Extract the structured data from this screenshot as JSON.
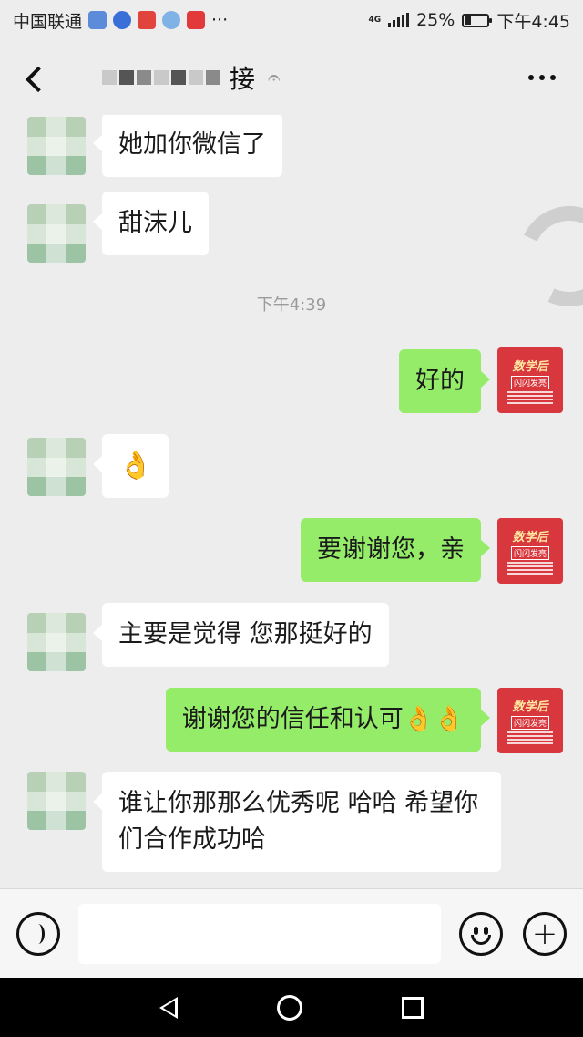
{
  "status_bar": {
    "carrier": "中国联通",
    "network": "4G",
    "battery": "25%",
    "battery_level": 0.25,
    "time": "下午4:45",
    "more": "···"
  },
  "header": {
    "title_visible": "接",
    "back_icon": "back-arrow-icon",
    "ear_icon": "ear-icon",
    "more_icon": "more-dots-icon"
  },
  "messages": [
    {
      "side": "in",
      "text": "她加你微信了"
    },
    {
      "side": "in",
      "text": "甜沫儿"
    },
    {
      "side": "time",
      "text": "下午4:39"
    },
    {
      "side": "out",
      "text": "好的"
    },
    {
      "side": "in",
      "text": "👌"
    },
    {
      "side": "out",
      "text": "要谢谢您，亲"
    },
    {
      "side": "in",
      "text": "主要是觉得 您那挺好的"
    },
    {
      "side": "out",
      "text": "谢谢您的信任和认可👌👌"
    },
    {
      "side": "in",
      "text": "谁让你那那么优秀呢 哈哈  希望你们合作成功哈"
    }
  ],
  "self_avatar": {
    "brand": "数学后",
    "box": "闪闪发亮"
  },
  "input_bar": {
    "voice_icon": "voice-icon",
    "emoji_icon": "emoji-icon",
    "plus_icon": "plus-icon",
    "plus": "+"
  },
  "nav_bar": {
    "back_icon": "nav-back-icon",
    "home_icon": "nav-home-icon",
    "recent_icon": "nav-recent-icon"
  },
  "colors": {
    "background": "#ededed",
    "bubble_out": "#95ec69",
    "bubble_in": "#ffffff",
    "brand_red": "#d8383d"
  }
}
